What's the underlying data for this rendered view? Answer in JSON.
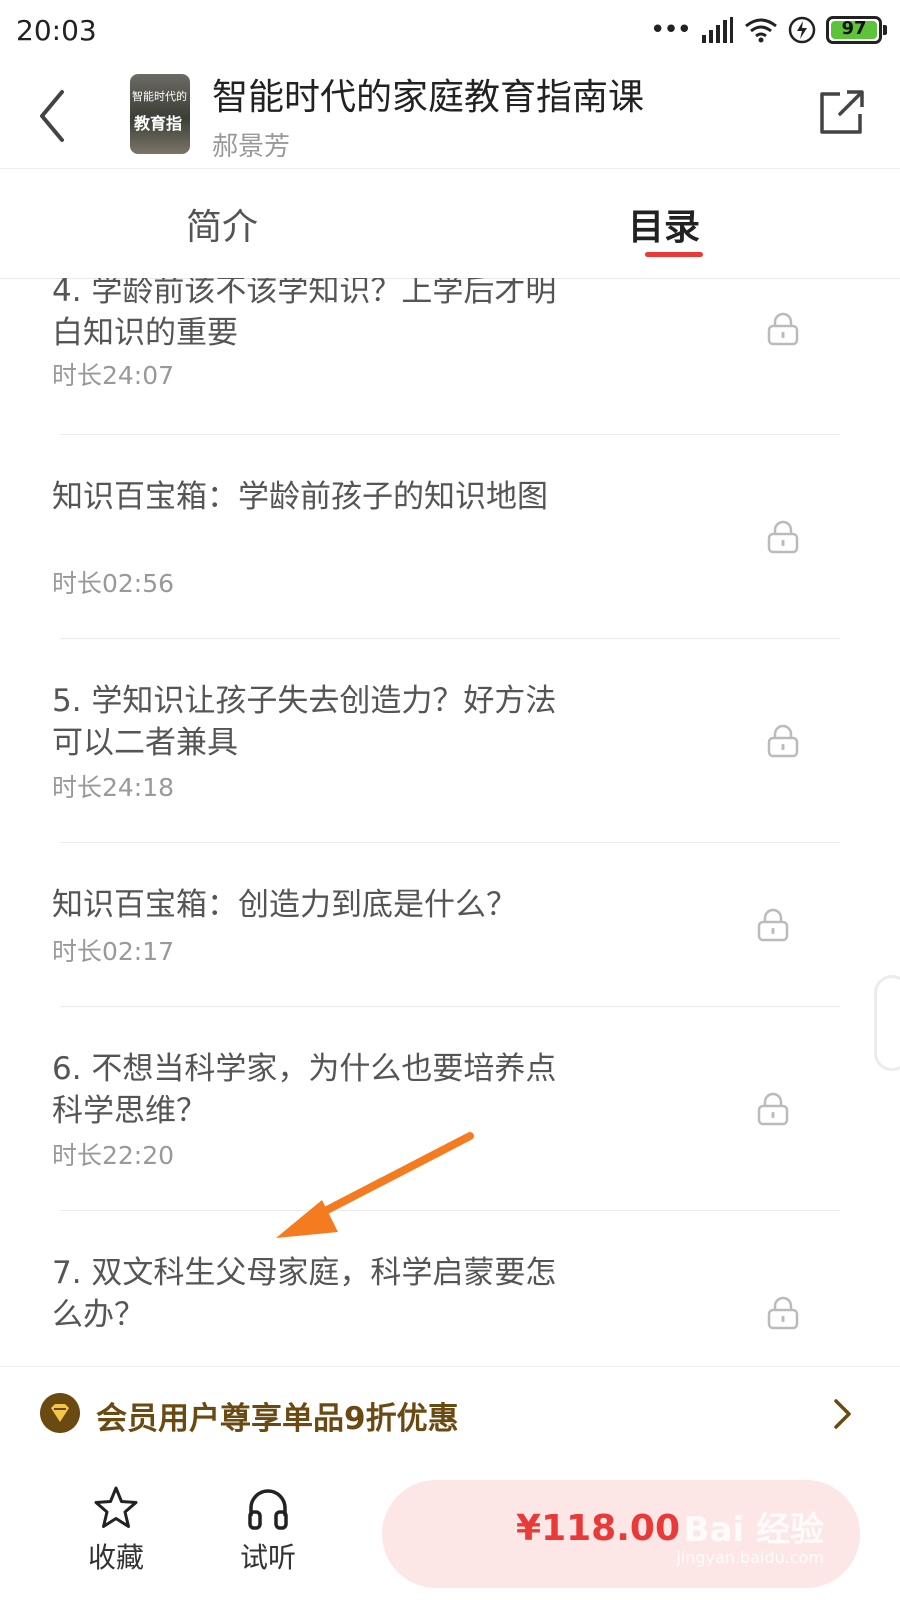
{
  "status_bar": {
    "time": "20:03",
    "battery": "97",
    "dots": "•••"
  },
  "header": {
    "cover_line1": "智能时代的",
    "cover_line2": "教育指",
    "title": "智能时代的家庭教育指南课",
    "author": "郝景芳"
  },
  "tabs": [
    {
      "label": "简介",
      "active": false
    },
    {
      "label": "目录",
      "active": true
    }
  ],
  "lessons": [
    {
      "title": "4. 学龄前该不该学知识？上学后才明白知识的重要",
      "duration": "时长24:07",
      "locked": true
    },
    {
      "title": "知识百宝箱：学龄前孩子的知识地图",
      "duration": "时长02:56",
      "locked": true
    },
    {
      "title": "5. 学知识让孩子失去创造力？好方法可以二者兼具",
      "duration": "时长24:18",
      "locked": true
    },
    {
      "title": "知识百宝箱：创造力到底是什么？",
      "duration": "时长02:17",
      "locked": true
    },
    {
      "title": "6. 不想当科学家，为什么也要培养点科学思维？",
      "duration": "时长22:20",
      "locked": true
    },
    {
      "title": "7. 双文科生父母家庭，科学启蒙要怎么办？",
      "duration": "",
      "locked": true
    }
  ],
  "promo": {
    "text": "会员用户尊享单品9折优惠"
  },
  "bottom_bar": {
    "favorite_label": "收藏",
    "trial_label": "试听",
    "price": "¥118.00"
  },
  "watermark": {
    "main": "Bai 经验",
    "sub": "jingyan.baidu.com"
  },
  "colors": {
    "accent": "#e93a3a",
    "promo": "#6b4a12",
    "buy_bg": "#fde6e6"
  }
}
